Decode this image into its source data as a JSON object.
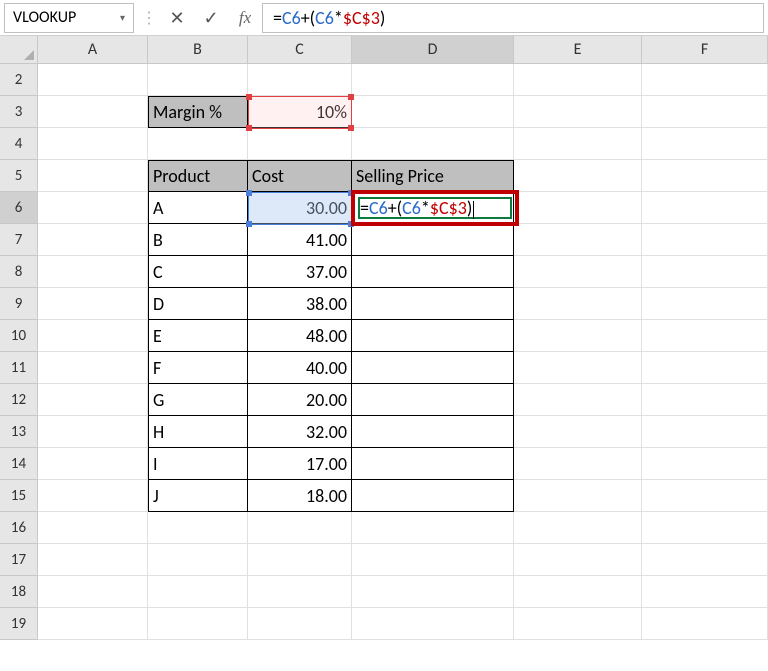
{
  "formula_bar": {
    "name_box": "VLOOKUP",
    "cancel_icon": "✕",
    "confirm_icon": "✓",
    "fx_label": "fx",
    "formula_plain": "=C6+(C6*$C$3)"
  },
  "columns": [
    "A",
    "B",
    "C",
    "D",
    "E",
    "F"
  ],
  "rows": [
    "2",
    "3",
    "4",
    "5",
    "6",
    "7",
    "8",
    "9",
    "10",
    "11",
    "12",
    "13",
    "14",
    "15",
    "16",
    "17",
    "18",
    "19"
  ],
  "active_col": "D",
  "active_row": "6",
  "margin": {
    "label": "Margin %",
    "value": "10%"
  },
  "headers": {
    "product": "Product",
    "cost": "Cost",
    "selling": "Selling Price"
  },
  "data_rows": [
    {
      "p": "A",
      "c": "30.00"
    },
    {
      "p": "B",
      "c": "41.00"
    },
    {
      "p": "C",
      "c": "37.00"
    },
    {
      "p": "D",
      "c": "38.00"
    },
    {
      "p": "E",
      "c": "48.00"
    },
    {
      "p": "F",
      "c": "40.00"
    },
    {
      "p": "G",
      "c": "20.00"
    },
    {
      "p": "H",
      "c": "32.00"
    },
    {
      "p": "I",
      "c": "17.00"
    },
    {
      "p": "J",
      "c": "18.00"
    }
  ],
  "editing_formula": "=C6+(C6*$C$3)"
}
